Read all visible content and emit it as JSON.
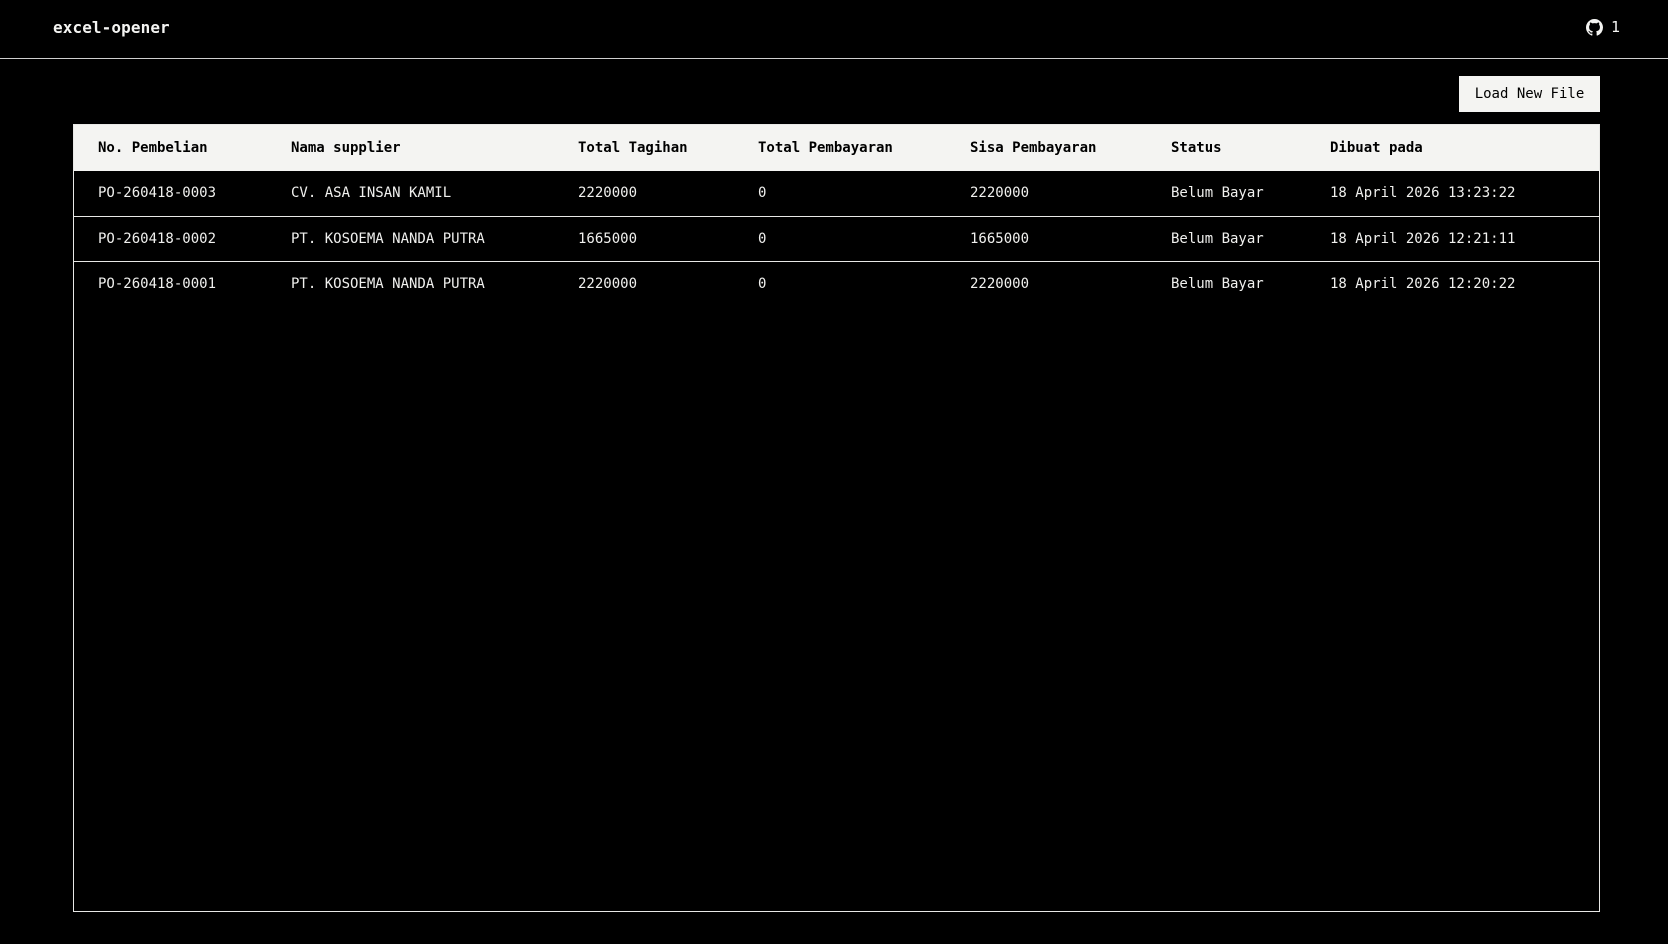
{
  "header": {
    "title": "excel-opener",
    "github_count": "1"
  },
  "toolbar": {
    "load_label": "Load New File"
  },
  "table": {
    "columns": [
      "No. Pembelian",
      "Nama supplier",
      "Total Tagihan",
      "Total Pembayaran",
      "Sisa Pembayaran",
      "Status",
      "Dibuat pada"
    ],
    "rows": [
      [
        "PO-260418-0003",
        "CV. ASA INSAN KAMIL",
        "2220000",
        "0",
        "2220000",
        "Belum Bayar",
        "18 April 2026 13:23:22"
      ],
      [
        "PO-260418-0002",
        "PT. KOSOEMA NANDA PUTRA",
        "1665000",
        "0",
        "1665000",
        "Belum Bayar",
        "18 April 2026 12:21:11"
      ],
      [
        "PO-260418-0001",
        "PT. KOSOEMA NANDA PUTRA",
        "2220000",
        "0",
        "2220000",
        "Belum Bayar",
        "18 April 2026 12:20:22"
      ]
    ]
  }
}
